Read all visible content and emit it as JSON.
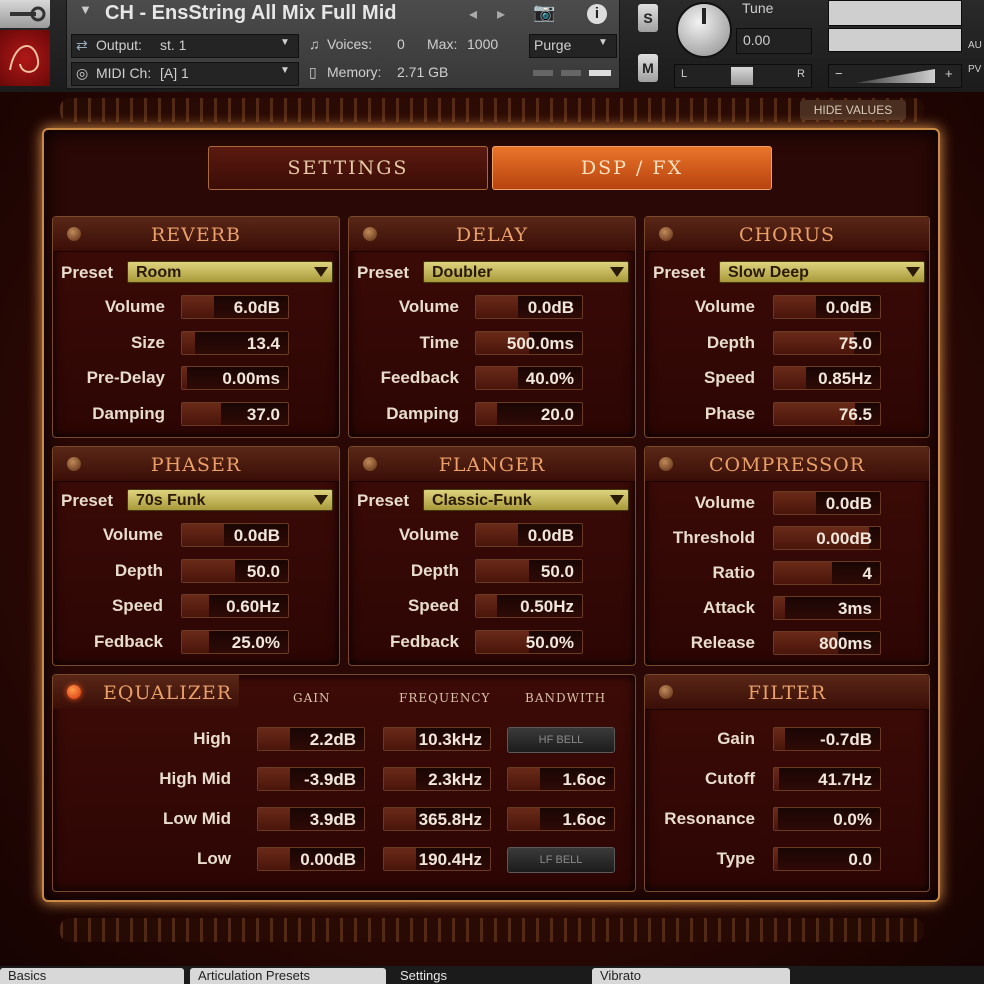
{
  "header": {
    "instrument_name": "CH - EnsString All Mix Full Mid",
    "output_label": "Output:",
    "output_value": "st. 1",
    "voices_label": "Voices:",
    "voices_value": "0",
    "max_label": "Max:",
    "max_value": "1000",
    "purge_label": "Purge",
    "midi_label": "MIDI Ch:",
    "midi_value": "[A] 1",
    "memory_label": "Memory:",
    "memory_value": "2.71 GB",
    "solo_label": "S",
    "mute_label": "M",
    "tune_label": "Tune",
    "tune_value": "0.00",
    "pan_left": "L",
    "pan_right": "R",
    "aux_label": "AU",
    "pv_label": "PV"
  },
  "hide_values_label": "HIDE VALUES",
  "tabs": {
    "settings": "SETTINGS",
    "dsp": "DSP / FX"
  },
  "preset_label": "Preset",
  "reverb": {
    "title": "REVERB",
    "preset": "Room",
    "params": [
      {
        "label": "Volume",
        "value": "6.0dB",
        "fill": 0.3
      },
      {
        "label": "Size",
        "value": "13.4",
        "fill": 0.12
      },
      {
        "label": "Pre-Delay",
        "value": "0.00ms",
        "fill": 0.05
      },
      {
        "label": "Damping",
        "value": "37.0",
        "fill": 0.37
      }
    ]
  },
  "delay": {
    "title": "DELAY",
    "preset": "Doubler",
    "params": [
      {
        "label": "Volume",
        "value": "0.0dB",
        "fill": 0.4
      },
      {
        "label": "Time",
        "value": "500.0ms",
        "fill": 0.5
      },
      {
        "label": "Feedback",
        "value": "40.0%",
        "fill": 0.4
      },
      {
        "label": "Damping",
        "value": "20.0",
        "fill": 0.2
      }
    ]
  },
  "chorus": {
    "title": "CHORUS",
    "preset": "Slow Deep",
    "params": [
      {
        "label": "Volume",
        "value": "0.0dB",
        "fill": 0.4
      },
      {
        "label": "Depth",
        "value": "75.0",
        "fill": 0.75
      },
      {
        "label": "Speed",
        "value": "0.85Hz",
        "fill": 0.3
      },
      {
        "label": "Phase",
        "value": "76.5",
        "fill": 0.76
      }
    ]
  },
  "phaser": {
    "title": "PHASER",
    "preset": "70s Funk",
    "params": [
      {
        "label": "Volume",
        "value": "0.0dB",
        "fill": 0.4
      },
      {
        "label": "Depth",
        "value": "50.0",
        "fill": 0.5
      },
      {
        "label": "Speed",
        "value": "0.60Hz",
        "fill": 0.25
      },
      {
        "label": "Fedback",
        "value": "25.0%",
        "fill": 0.25
      }
    ]
  },
  "flanger": {
    "title": "FLANGER",
    "preset": "Classic-Funk",
    "params": [
      {
        "label": "Volume",
        "value": "0.0dB",
        "fill": 0.4
      },
      {
        "label": "Depth",
        "value": "50.0",
        "fill": 0.5
      },
      {
        "label": "Speed",
        "value": "0.50Hz",
        "fill": 0.2
      },
      {
        "label": "Fedback",
        "value": "50.0%",
        "fill": 0.5
      }
    ]
  },
  "compressor": {
    "title": "COMPRESSOR",
    "params": [
      {
        "label": "Volume",
        "value": "0.0dB",
        "fill": 0.4
      },
      {
        "label": "Threshold",
        "value": "0.00dB",
        "fill": 0.9
      },
      {
        "label": "Ratio",
        "value": "4",
        "fill": 0.55
      },
      {
        "label": "Attack",
        "value": "3ms",
        "fill": 0.1
      },
      {
        "label": "Release",
        "value": "800ms",
        "fill": 0.6
      }
    ]
  },
  "equalizer": {
    "title": "EQUALIZER",
    "col_gain": "GAIN",
    "col_frequency": "FREQUENCY",
    "col_bandwidth": "BANDWITH",
    "rows": [
      {
        "label": "High",
        "gain": "2.2dB",
        "frequency": "10.3kHz",
        "bandwidth": "HF BELL",
        "bell": true
      },
      {
        "label": "High Mid",
        "gain": "-3.9dB",
        "frequency": "2.3kHz",
        "bandwidth": "1.6oc",
        "bell": false
      },
      {
        "label": "Low Mid",
        "gain": "3.9dB",
        "frequency": "365.8Hz",
        "bandwidth": "1.6oc",
        "bell": false
      },
      {
        "label": "Low",
        "gain": "0.00dB",
        "frequency": "190.4Hz",
        "bandwidth": "LF BELL",
        "bell": true
      }
    ]
  },
  "filter": {
    "title": "FILTER",
    "params": [
      {
        "label": "Gain",
        "value": "-0.7dB",
        "fill": 0.1
      },
      {
        "label": "Cutoff",
        "value": "41.7Hz",
        "fill": 0.05
      },
      {
        "label": "Resonance",
        "value": "0.0%",
        "fill": 0.0
      },
      {
        "label": "Type",
        "value": "0.0",
        "fill": 0.0
      }
    ]
  },
  "bottom_tabs": [
    "Basics",
    "Articulation Presets",
    "Settings",
    "Vibrato"
  ]
}
